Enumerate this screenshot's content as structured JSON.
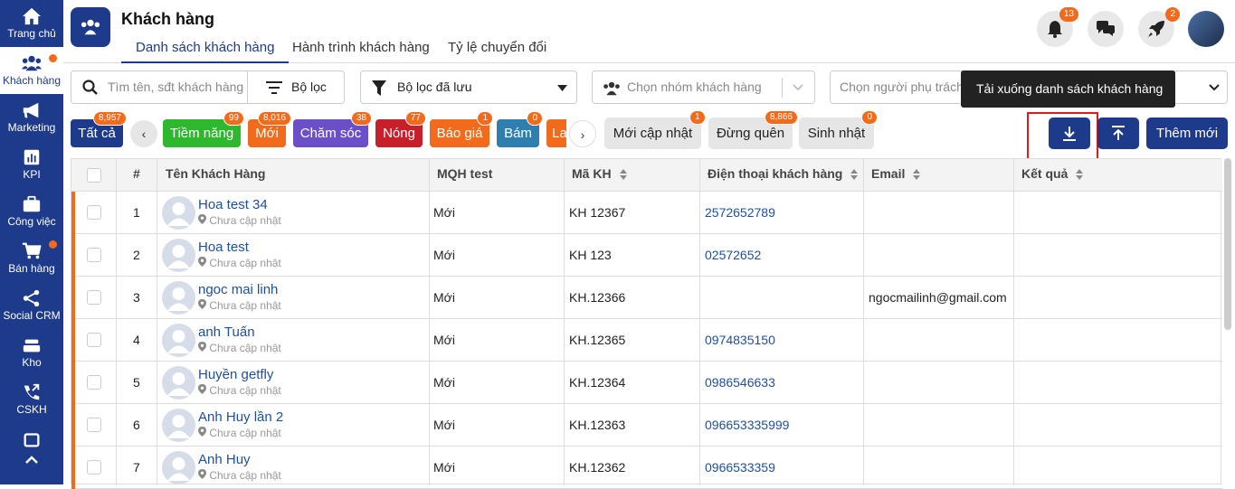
{
  "sidebar": {
    "items": [
      {
        "label": "Trang chủ",
        "icon": "home-icon"
      },
      {
        "label": "Khách hàng",
        "icon": "customers-icon",
        "active": true,
        "dot": true
      },
      {
        "label": "Marketing",
        "icon": "megaphone-icon"
      },
      {
        "label": "KPI",
        "icon": "chart-icon"
      },
      {
        "label": "Công việc",
        "icon": "briefcase-icon"
      },
      {
        "label": "Bán hàng",
        "icon": "cart-icon",
        "dot": true
      },
      {
        "label": "Social CRM",
        "icon": "share-icon"
      },
      {
        "label": "Kho",
        "icon": "warehouse-icon"
      },
      {
        "label": "CSKH",
        "icon": "phone-icon"
      }
    ]
  },
  "header": {
    "title": "Khách hàng",
    "tabs": [
      "Danh sách khách hàng",
      "Hành trình khách hàng",
      "Tỷ lệ chuyển đổi"
    ],
    "notif_count": "13",
    "rocket_count": "2"
  },
  "filters": {
    "search_placeholder": "Tìm tên, sđt khách hàng",
    "filter_label": "Bộ lọc",
    "saved_filter_label": "Bộ lọc đã lưu",
    "group_placeholder": "Chọn nhóm khách hàng",
    "owner_placeholder": "Chọn người phụ trách"
  },
  "tooltip": "Tải xuống danh sách khách hàng",
  "chips": [
    {
      "label": "Tất cả",
      "count": "8,957",
      "color": "#1e3a8a"
    },
    {
      "label": "Tiềm năng",
      "count": "99",
      "color": "#2eb82e"
    },
    {
      "label": "Mới",
      "count": "8,016",
      "color": "#f26b1d"
    },
    {
      "label": "Chăm sóc",
      "count": "38",
      "color": "#6b4fc9"
    },
    {
      "label": "Nóng",
      "count": "77",
      "color": "#c8202a"
    },
    {
      "label": "Báo giá",
      "count": "1",
      "color": "#f26b1d"
    },
    {
      "label": "Bám",
      "count": "0",
      "color": "#2e7fb0"
    },
    {
      "label": "La",
      "count": "",
      "color": "#f26b1d"
    }
  ],
  "quick_filters": [
    {
      "label": "Mới cập nhật",
      "count": "1"
    },
    {
      "label": "Đừng quên",
      "count": "8,866"
    },
    {
      "label": "Sinh nhật",
      "count": "0"
    }
  ],
  "actions": {
    "add_label": "Thêm mới"
  },
  "table": {
    "headers": [
      "#",
      "Tên Khách Hàng",
      "MQH test",
      "Mã KH",
      "Điện thoại khách hàng",
      "Email",
      "Kết quả"
    ],
    "rows": [
      {
        "num": "1",
        "name": "Hoa test 34",
        "addr": "Chưa cập nhật",
        "mqh": "Mới",
        "code": "KH 12367",
        "phone": "2572652789",
        "email": ""
      },
      {
        "num": "2",
        "name": "Hoa test",
        "addr": "Chưa cập nhật",
        "mqh": "Mới",
        "code": "KH 123",
        "phone": "02572652",
        "email": ""
      },
      {
        "num": "3",
        "name": "ngoc mai linh",
        "addr": "Chưa cập nhật",
        "mqh": "Mới",
        "code": "KH.12366",
        "phone": "",
        "email": "ngocmailinh@gmail.com"
      },
      {
        "num": "4",
        "name": "anh Tuấn",
        "addr": "Chưa cập nhật",
        "mqh": "Mới",
        "code": "KH.12365",
        "phone": "0974835150",
        "email": ""
      },
      {
        "num": "5",
        "name": "Huyền getfly",
        "addr": "Chưa cập nhật",
        "mqh": "Mới",
        "code": "KH.12364",
        "phone": "0986546633",
        "email": ""
      },
      {
        "num": "6",
        "name": "Anh Huy lần 2",
        "addr": "Chưa cập nhật",
        "mqh": "Mới",
        "code": "KH.12363",
        "phone": "096653335999",
        "email": ""
      },
      {
        "num": "7",
        "name": "Anh Huy",
        "addr": "Chưa cập nhật",
        "mqh": "Mới",
        "code": "KH.12362",
        "phone": "0966533359",
        "email": ""
      }
    ]
  }
}
